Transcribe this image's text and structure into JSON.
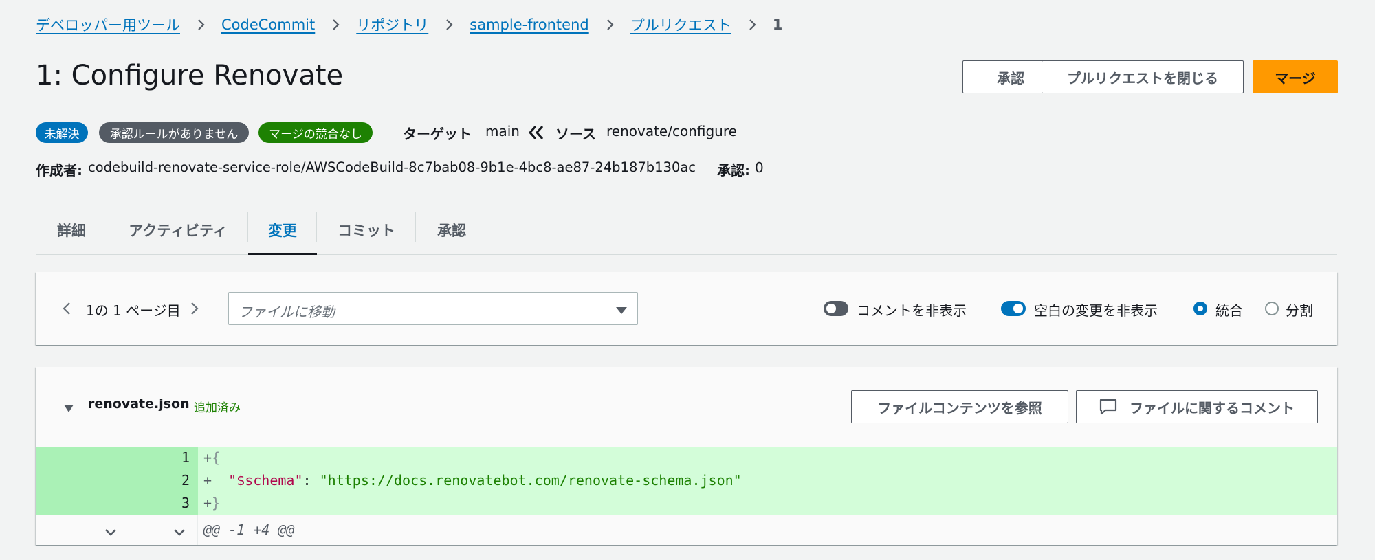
{
  "breadcrumb": {
    "items": [
      "デベロッパー用ツール",
      "CodeCommit",
      "リポジトリ",
      "sample-frontend",
      "プルリクエスト"
    ],
    "current": "1"
  },
  "header": {
    "title": "1: Configure Renovate",
    "approve_label": "承認",
    "close_label": "プルリクエストを閉じる",
    "merge_label": "マージ"
  },
  "status": {
    "badges": [
      "未解決",
      "承認ルールがありません",
      "マージの競合なし"
    ],
    "target_label": "ターゲット",
    "target_value": "main",
    "source_label": "ソース",
    "source_value": "renovate/configure"
  },
  "meta": {
    "author_label": "作成者:",
    "author_value": "codebuild-renovate-service-role/AWSCodeBuild-8c7bab08-9b1e-4bc8-ae87-24b187b130ac",
    "approvals_label": "承認:",
    "approvals_value": "0"
  },
  "tabs": [
    {
      "label": "詳細",
      "active": false
    },
    {
      "label": "アクティビティ",
      "active": false
    },
    {
      "label": "変更",
      "active": true
    },
    {
      "label": "コミット",
      "active": false
    },
    {
      "label": "承認",
      "active": false
    }
  ],
  "toolbar": {
    "page_text": "1の 1 ページ目",
    "file_select_placeholder": "ファイルに移動",
    "hide_comments_label": "コメントを非表示",
    "hide_comments_on": false,
    "hide_whitespace_label": "空白の変更を非表示",
    "hide_whitespace_on": true,
    "unified_label": "統合",
    "split_label": "分割",
    "selected_view": "統合"
  },
  "file": {
    "name": "renovate.json",
    "status": "追加済み",
    "browse_label": "ファイルコンテンツを参照",
    "comment_label": "ファイルに関するコメント",
    "lines": [
      {
        "num": "1",
        "sign": "+",
        "text": "{"
      },
      {
        "num": "2",
        "sign": "+",
        "key": "\"$schema\"",
        "sep": ": ",
        "value": "\"https://docs.renovatebot.com/renovate-schema.json\""
      },
      {
        "num": "3",
        "sign": "+",
        "text": "}"
      }
    ],
    "hunk": "@@ -1 +4 @@"
  },
  "colors": {
    "link": "#0073bb",
    "primary": "#ff9900",
    "badge_open": "#0073bb",
    "badge_rules": "#545b64",
    "badge_merge": "#1d8102",
    "added_bg": "#d3fdd9",
    "added_gutter_bg": "#aaf1b6"
  }
}
